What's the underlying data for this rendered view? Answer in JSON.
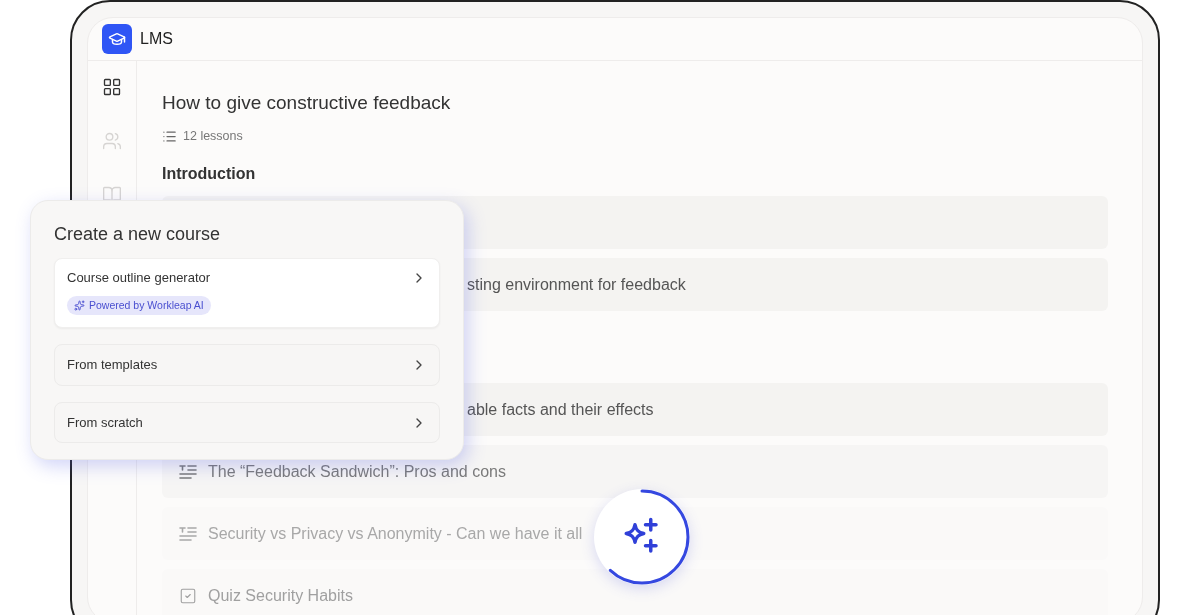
{
  "app": {
    "name": "LMS"
  },
  "sidebar": {
    "items": [
      {
        "kind": "grid",
        "selected": true
      },
      {
        "kind": "users",
        "selected": false
      },
      {
        "kind": "book",
        "selected": false
      }
    ]
  },
  "course": {
    "title": "How to give constructive feedback",
    "lesson_count": "12 lessons",
    "section": "Introduction",
    "lessons": [
      {
        "kind": "hidden"
      },
      {
        "kind": "partial",
        "label": "sting environment for feedback"
      },
      {
        "kind": "gap"
      },
      {
        "kind": "partial",
        "label": "able facts and their effects"
      },
      {
        "kind": "text",
        "label": "The “Feedback Sandwich”: Pros and cons"
      },
      {
        "kind": "text",
        "label": "Security vs Privacy vs Anonymity  - Can we have it all"
      },
      {
        "kind": "quiz",
        "label": "Quiz Security Habits"
      }
    ]
  },
  "popup": {
    "title": "Create a new course",
    "options": [
      {
        "label": "Course outline generator",
        "badge": "Powered by Workleap AI",
        "highlighted": true
      },
      {
        "label": "From templates",
        "highlighted": false
      },
      {
        "label": "From scratch",
        "highlighted": false
      }
    ]
  }
}
